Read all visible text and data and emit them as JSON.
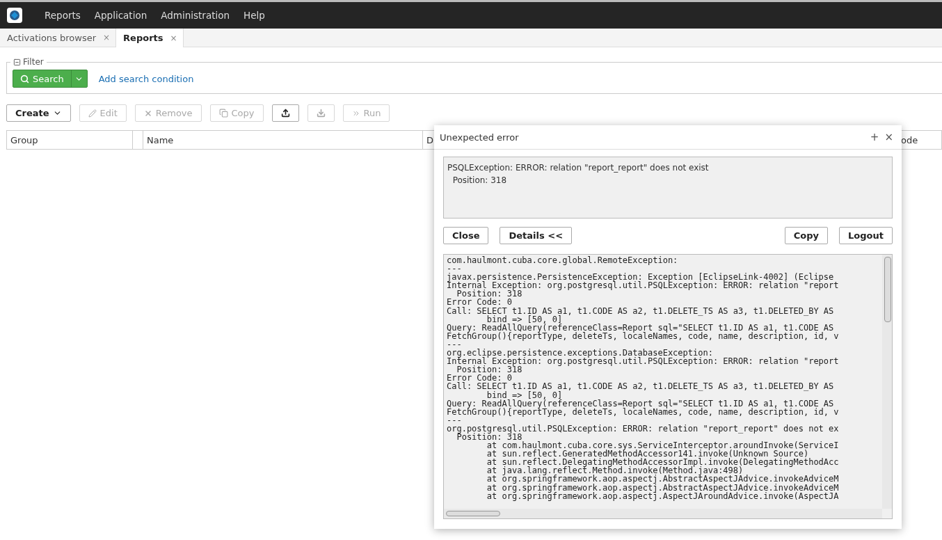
{
  "menu": [
    "Reports",
    "Application",
    "Administration",
    "Help"
  ],
  "tabs": [
    {
      "label": "Activations browser",
      "selected": false,
      "close": "×"
    },
    {
      "label": "Reports",
      "selected": true,
      "close": "×"
    }
  ],
  "filter": {
    "legend": "Filter",
    "search_button": "Search",
    "add_condition": "Add search condition"
  },
  "toolbar": [
    {
      "label": "Create",
      "kind": "dropdown",
      "disabled": false
    },
    {
      "label": "Edit",
      "kind": "edit",
      "disabled": true
    },
    {
      "label": "Remove",
      "kind": "remove",
      "disabled": true
    },
    {
      "label": "Copy",
      "kind": "copy",
      "disabled": true
    },
    {
      "kind": "upload",
      "disabled": false
    },
    {
      "kind": "download",
      "disabled": true
    },
    {
      "label": "Run",
      "kind": "run",
      "disabled": true
    }
  ],
  "table": {
    "columns": [
      "Group",
      "",
      "Name",
      "D",
      "ode"
    ]
  },
  "dialog": {
    "title": "Unexpected error",
    "maximize": "+",
    "close": "×",
    "message": [
      "PSQLException: ERROR: relation \"report_report\" does not exist",
      "  Position: 318"
    ],
    "left_buttons": [
      "Close",
      "Details <<"
    ],
    "right_buttons": [
      "Copy",
      "Logout"
    ],
    "details": [
      "com.haulmont.cuba.core.global.RemoteException:",
      "---",
      "javax.persistence.PersistenceException: Exception [EclipseLink-4002] (Eclipse",
      "Internal Exception: org.postgresql.util.PSQLException: ERROR: relation \"report",
      "  Position: 318",
      "Error Code: 0",
      "Call: SELECT t1.ID AS a1, t1.CODE AS a2, t1.DELETE_TS AS a3, t1.DELETED_BY AS",
      "        bind => [50, 0]",
      "Query: ReadAllQuery(referenceClass=Report sql=\"SELECT t1.ID AS a1, t1.CODE AS",
      "FetchGroup(){reportType, deleteTs, localeNames, code, name, description, id, v",
      "---",
      "org.eclipse.persistence.exceptions.DatabaseException:",
      "Internal Exception: org.postgresql.util.PSQLException: ERROR: relation \"report",
      "  Position: 318",
      "Error Code: 0",
      "Call: SELECT t1.ID AS a1, t1.CODE AS a2, t1.DELETE_TS AS a3, t1.DELETED_BY AS",
      "        bind => [50, 0]",
      "Query: ReadAllQuery(referenceClass=Report sql=\"SELECT t1.ID AS a1, t1.CODE AS",
      "FetchGroup(){reportType, deleteTs, localeNames, code, name, description, id, v",
      "---",
      "org.postgresql.util.PSQLException: ERROR: relation \"report_report\" does not ex",
      "  Position: 318",
      "        at com.haulmont.cuba.core.sys.ServiceInterceptor.aroundInvoke(ServiceI",
      "        at sun.reflect.GeneratedMethodAccessor141.invoke(Unknown Source)",
      "        at sun.reflect.DelegatingMethodAccessorImpl.invoke(DelegatingMethodAcc",
      "        at java.lang.reflect.Method.invoke(Method.java:498)",
      "        at org.springframework.aop.aspectj.AbstractAspectJAdvice.invokeAdviceM",
      "        at org.springframework.aop.aspectj.AbstractAspectJAdvice.invokeAdviceM",
      "        at org.springframework.aop.aspectj.AspectJAroundAdvice.invoke(AspectJA"
    ]
  }
}
